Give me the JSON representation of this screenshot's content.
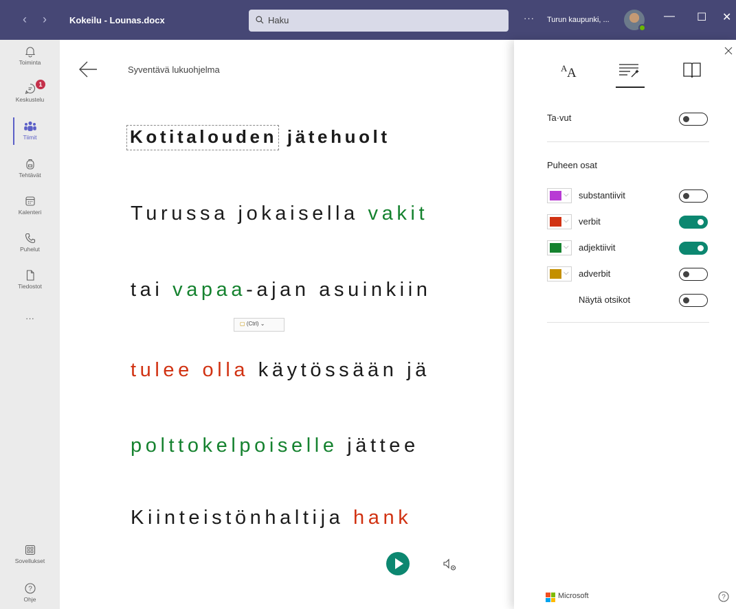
{
  "titlebar": {
    "doc_title": "Kokeilu - Lounas.docx",
    "search_placeholder": "Haku",
    "more": "···",
    "org": "Turun kaupunki, ..."
  },
  "rail": {
    "items": [
      {
        "label": "Toiminta"
      },
      {
        "label": "Keskustelu",
        "badge": "1"
      },
      {
        "label": "Tiimit"
      },
      {
        "label": "Tehtävät"
      },
      {
        "label": "Kalenteri"
      },
      {
        "label": "Puhelut"
      },
      {
        "label": "Tiedostot"
      }
    ],
    "more": "···",
    "apps": "Sovellukset",
    "help": "Ohje"
  },
  "reader": {
    "title": "Syventävä lukuohjelma",
    "lines": [
      {
        "parts": [
          "Kotitalouden",
          " jätehuolt"
        ]
      },
      {
        "parts": [
          "Turussa jokaisella ",
          "vakit"
        ]
      },
      {
        "parts": [
          "tai ",
          "vapaa",
          "-ajan asuinkiin"
        ]
      },
      {
        "parts": [
          "tulee olla",
          " käytössään jä"
        ]
      },
      {
        "parts": [
          "polttokelpoiselle",
          " jättee"
        ]
      },
      {
        "parts": [
          "Kiinteistönhaltija ",
          "hank"
        ]
      }
    ],
    "paste_chip": "(Ctrl)"
  },
  "panel": {
    "syllables": {
      "label": "Ta·vut",
      "on": false
    },
    "parts_heading": "Puheen osat",
    "parts": [
      {
        "label": "substantiivit",
        "color": "#b83bd4",
        "on": false
      },
      {
        "label": "verbit",
        "color": "#d13212",
        "on": true
      },
      {
        "label": "adjektiivit",
        "color": "#15822f",
        "on": true
      },
      {
        "label": "adverbit",
        "color": "#c49000",
        "on": false
      }
    ],
    "show_labels": {
      "label": "Näytä otsikot",
      "on": false
    },
    "footer": "Microsoft"
  },
  "colors": {
    "titlebar": "#464775",
    "accent": "#5b5fc7",
    "toggle_on": "#0c8770",
    "green_text": "#15822f",
    "red_text": "#d13212"
  }
}
